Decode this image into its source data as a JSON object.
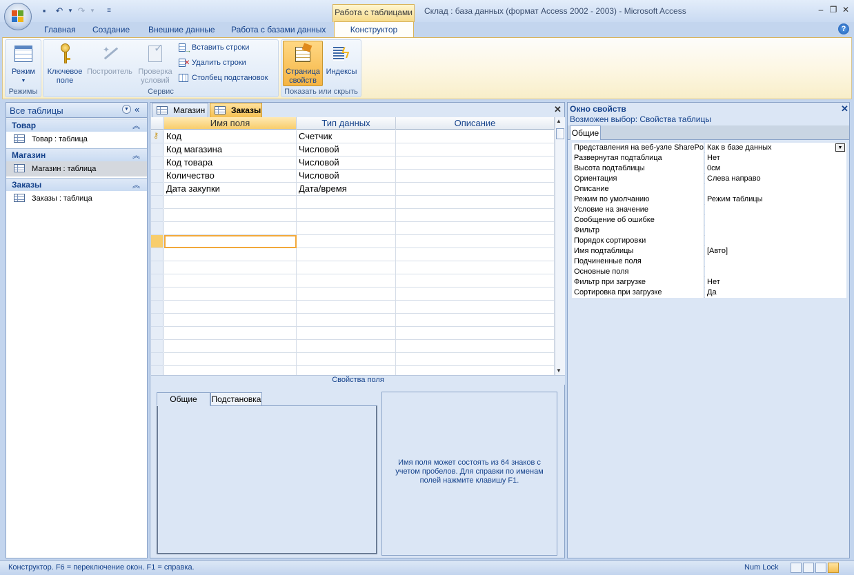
{
  "app": {
    "window_title": "Склад : база данных (формат Access 2002 - 2003) - Microsoft Access",
    "context_tab_group": "Работа с таблицами"
  },
  "ribbon": {
    "tabs": [
      "Главная",
      "Создание",
      "Внешние данные",
      "Работа с базами данных",
      "Конструктор"
    ],
    "active_tab": "Конструктор",
    "groups": {
      "modes": {
        "label": "Режимы",
        "view_button": "Режим"
      },
      "service": {
        "label": "Сервис",
        "primary_key_l1": "Ключевое",
        "primary_key_l2": "поле",
        "builder": "Построитель",
        "validation_l1": "Проверка",
        "validation_l2": "условий",
        "insert_rows": "Вставить строки",
        "delete_rows": "Удалить строки",
        "lookup_column": "Столбец  подстановок"
      },
      "show_hide": {
        "label": "Показать или скрыть",
        "property_sheet_l1": "Страница",
        "property_sheet_l2": "свойств",
        "indexes": "Индексы"
      }
    }
  },
  "nav": {
    "title": "Все таблицы",
    "groups": [
      {
        "header": "Товар",
        "item": "Товар : таблица"
      },
      {
        "header": "Магазин",
        "item": "Магазин : таблица"
      },
      {
        "header": "Заказы",
        "item": "Заказы : таблица"
      }
    ]
  },
  "doc": {
    "tabs": [
      "Магазин",
      "Заказы"
    ],
    "active_tab": "Заказы",
    "columns": [
      "Имя поля",
      "Тип данных",
      "Описание"
    ],
    "rows": [
      {
        "name": "Код",
        "type": "Счетчик",
        "desc": "",
        "key": true
      },
      {
        "name": "Код магазина",
        "type": "Числовой",
        "desc": ""
      },
      {
        "name": "Код товара",
        "type": "Числовой",
        "desc": ""
      },
      {
        "name": "Количество",
        "type": "Числовой",
        "desc": ""
      },
      {
        "name": "Дата закупки",
        "type": "Дата/время",
        "desc": ""
      }
    ],
    "field_props_label": "Свойства поля",
    "field_tabs": [
      "Общие",
      "Подстановка"
    ],
    "hint": "Имя поля может состоять из 64 знаков с учетом пробелов.  Для справки по именам полей нажмите клавишу F1."
  },
  "propsheet": {
    "title": "Окно свойств",
    "selection": "Возможен выбор:  Свойства таблицы",
    "tab": "Общие",
    "rows": [
      {
        "k": "Представления на веб-узле SharePoint",
        "v": "Как в базе данных",
        "dropdown": true
      },
      {
        "k": "Развернутая подтаблица",
        "v": "Нет"
      },
      {
        "k": "Высота подтаблицы",
        "v": "0см"
      },
      {
        "k": "Ориентация",
        "v": "Слева направо"
      },
      {
        "k": "Описание",
        "v": ""
      },
      {
        "k": "Режим по умолчанию",
        "v": "Режим таблицы"
      },
      {
        "k": "Условие на значение",
        "v": ""
      },
      {
        "k": "Сообщение об ошибке",
        "v": ""
      },
      {
        "k": "Фильтр",
        "v": ""
      },
      {
        "k": "Порядок сортировки",
        "v": ""
      },
      {
        "k": "Имя подтаблицы",
        "v": "[Авто]"
      },
      {
        "k": "Подчиненные поля",
        "v": ""
      },
      {
        "k": "Основные поля",
        "v": ""
      },
      {
        "k": "Фильтр при загрузке",
        "v": "Нет"
      },
      {
        "k": "Сортировка при загрузке",
        "v": "Да"
      }
    ]
  },
  "status": {
    "text": "Конструктор.  F6 = переключение окон.  F1 = справка.",
    "numlock": "Num Lock"
  },
  "colors": {
    "accent": "#15428b",
    "selected_tab": "#f8cd6c",
    "ribbon_bg": "#fdf7e4"
  }
}
